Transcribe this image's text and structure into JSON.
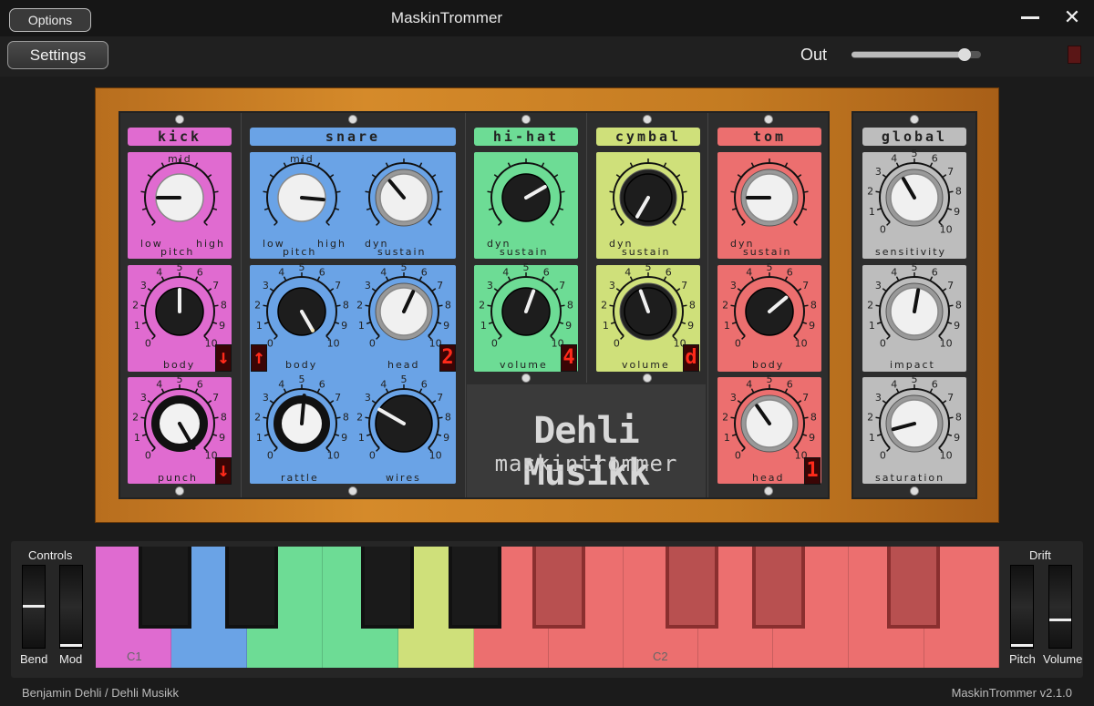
{
  "titlebar": {
    "title": "MaskinTrommer",
    "options_label": "Options"
  },
  "header": {
    "settings_label": "Settings",
    "out_label": "Out",
    "out_level": 0.87
  },
  "sections": {
    "kick": "kick",
    "snare": "snare",
    "hihat": "hi-hat",
    "cymbal": "cymbal",
    "tom": "tom",
    "global": "global"
  },
  "labels": {
    "kick_mid": "mid",
    "kick_low": "low",
    "kick_high": "high",
    "kick_pitch": "pitch",
    "kick_body": "body",
    "kick_punch": "punch",
    "snare_mid": "mid",
    "snare_low": "low",
    "snare_high": "high",
    "snare_pitch": "pitch",
    "snare_dyn": "dyn",
    "snare_sustain": "sustain",
    "snare_body": "body",
    "snare_head": "head",
    "snare_rattle": "rattle",
    "snare_wires": "wires",
    "hihat_dyn": "dyn",
    "hihat_sustain": "sustain",
    "hihat_volume": "volume",
    "cymbal_dyn": "dyn",
    "cymbal_sustain": "sustain",
    "cymbal_volume": "volume",
    "tom_dyn": "dyn",
    "tom_sustain": "sustain",
    "tom_body": "body",
    "tom_head": "head",
    "global_sensitivity": "sensitivity",
    "global_impact": "impact",
    "global_saturation": "saturation"
  },
  "displays": {
    "kick_body": "↓",
    "kick_punch": "↓",
    "snare_body": "↑",
    "snare_head": "2",
    "hihat": "4",
    "cymbal": "d",
    "tom_head": "1"
  },
  "logo": {
    "line1": "Dehli Musikk",
    "line2": "maskintrommer"
  },
  "keyboard": {
    "controls_label": "Controls",
    "bend_label": "Bend",
    "mod_label": "Mod",
    "drift_label": "Drift",
    "pitch_label": "Pitch",
    "volume_label": "Volume",
    "c1": "C1",
    "c2": "C2"
  },
  "footer": {
    "credit": "Benjamin Dehli  /  Dehli Musikk",
    "version": "MaskinTrommer  v2.1.0"
  },
  "scale": {
    "zero": "0",
    "one": "1",
    "two": "2",
    "three": "3",
    "four": "4",
    "five": "5",
    "six": "6",
    "seven": "7",
    "eight": "8",
    "nine": "9",
    "ten": "10"
  },
  "colors": {
    "kick": "#e06bd0",
    "snare": "#6aa3e6",
    "hihat": "#6ddc95",
    "cymbal": "#cfe07a",
    "tom": "#ec6f6f",
    "global": "#bdbdbd"
  }
}
